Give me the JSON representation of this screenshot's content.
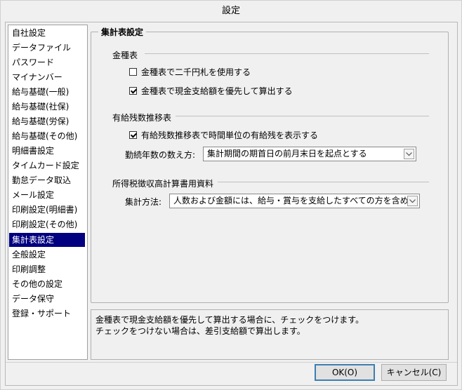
{
  "window": {
    "title": "設定"
  },
  "sidebar": {
    "selected_index": 15,
    "items": [
      {
        "label": "自社設定"
      },
      {
        "label": "データファイル"
      },
      {
        "label": "パスワード"
      },
      {
        "label": "マイナンバー"
      },
      {
        "label": "給与基礎(一般)"
      },
      {
        "label": "給与基礎(社保)"
      },
      {
        "label": "給与基礎(労保)"
      },
      {
        "label": "給与基礎(その他)"
      },
      {
        "label": "明細書設定"
      },
      {
        "label": "タイムカード設定"
      },
      {
        "label": "勤怠データ取込"
      },
      {
        "label": "メール設定"
      },
      {
        "label": "印刷設定(明細書)"
      },
      {
        "label": "印刷設定(その他)"
      },
      {
        "label": "集計表設定"
      },
      {
        "label": "全般設定"
      },
      {
        "label": "印刷調整"
      },
      {
        "label": "その他の設定"
      },
      {
        "label": "データ保守"
      },
      {
        "label": "登録・サポート"
      }
    ]
  },
  "panel": {
    "title": "集計表設定",
    "kinsyu": {
      "title": "金種表",
      "check1": {
        "label": "金種表で二千円札を使用する",
        "checked": false
      },
      "check2": {
        "label": "金種表で現金支給額を優先して算出する",
        "checked": true
      }
    },
    "yukyu": {
      "title": "有給残数推移表",
      "check1": {
        "label": "有給残数推移表で時間単位の有給残を表示する",
        "checked": true
      },
      "count_label": "勤続年数の数え方:",
      "count_value": "集計期間の期首日の前月末日を起点とする"
    },
    "shotoku": {
      "title": "所得税徴収高計算書用資料",
      "method_label": "集計方法:",
      "method_value": "人数および金額には、給与・賞与を支給したすべての方を含める"
    }
  },
  "help": {
    "line1": "金種表で現金支給額を優先して算出する場合に、チェックをつけます。",
    "line2": "チェックをつけない場合は、差引支給額で算出します。"
  },
  "buttons": {
    "ok": "OK(O)",
    "cancel": "キャンセル(C)"
  }
}
